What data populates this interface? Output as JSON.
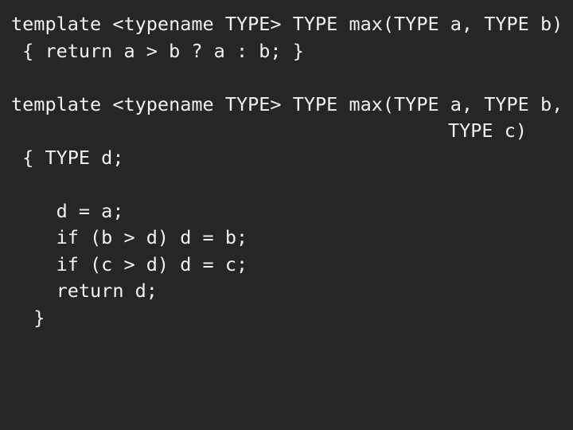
{
  "slide": {
    "background_color": "#262626",
    "text_color": "#f2f2f2",
    "blocks": [
      {
        "name": "two-argument-max-template",
        "lines": [
          "template <typename TYPE> TYPE max(TYPE a, TYPE b)",
          " { return a > b ? a : b; }"
        ]
      },
      {
        "name": "spacer",
        "lines": [
          " "
        ]
      },
      {
        "name": "three-argument-max-template",
        "lines": [
          "template <typename TYPE> TYPE max(TYPE a, TYPE b,",
          "TYPE c)",
          " { TYPE d;",
          " ",
          "    d = a;",
          "    if (b > d) d = b;",
          "    if (c > d) d = c;",
          "    return d;",
          "  }"
        ]
      }
    ]
  }
}
